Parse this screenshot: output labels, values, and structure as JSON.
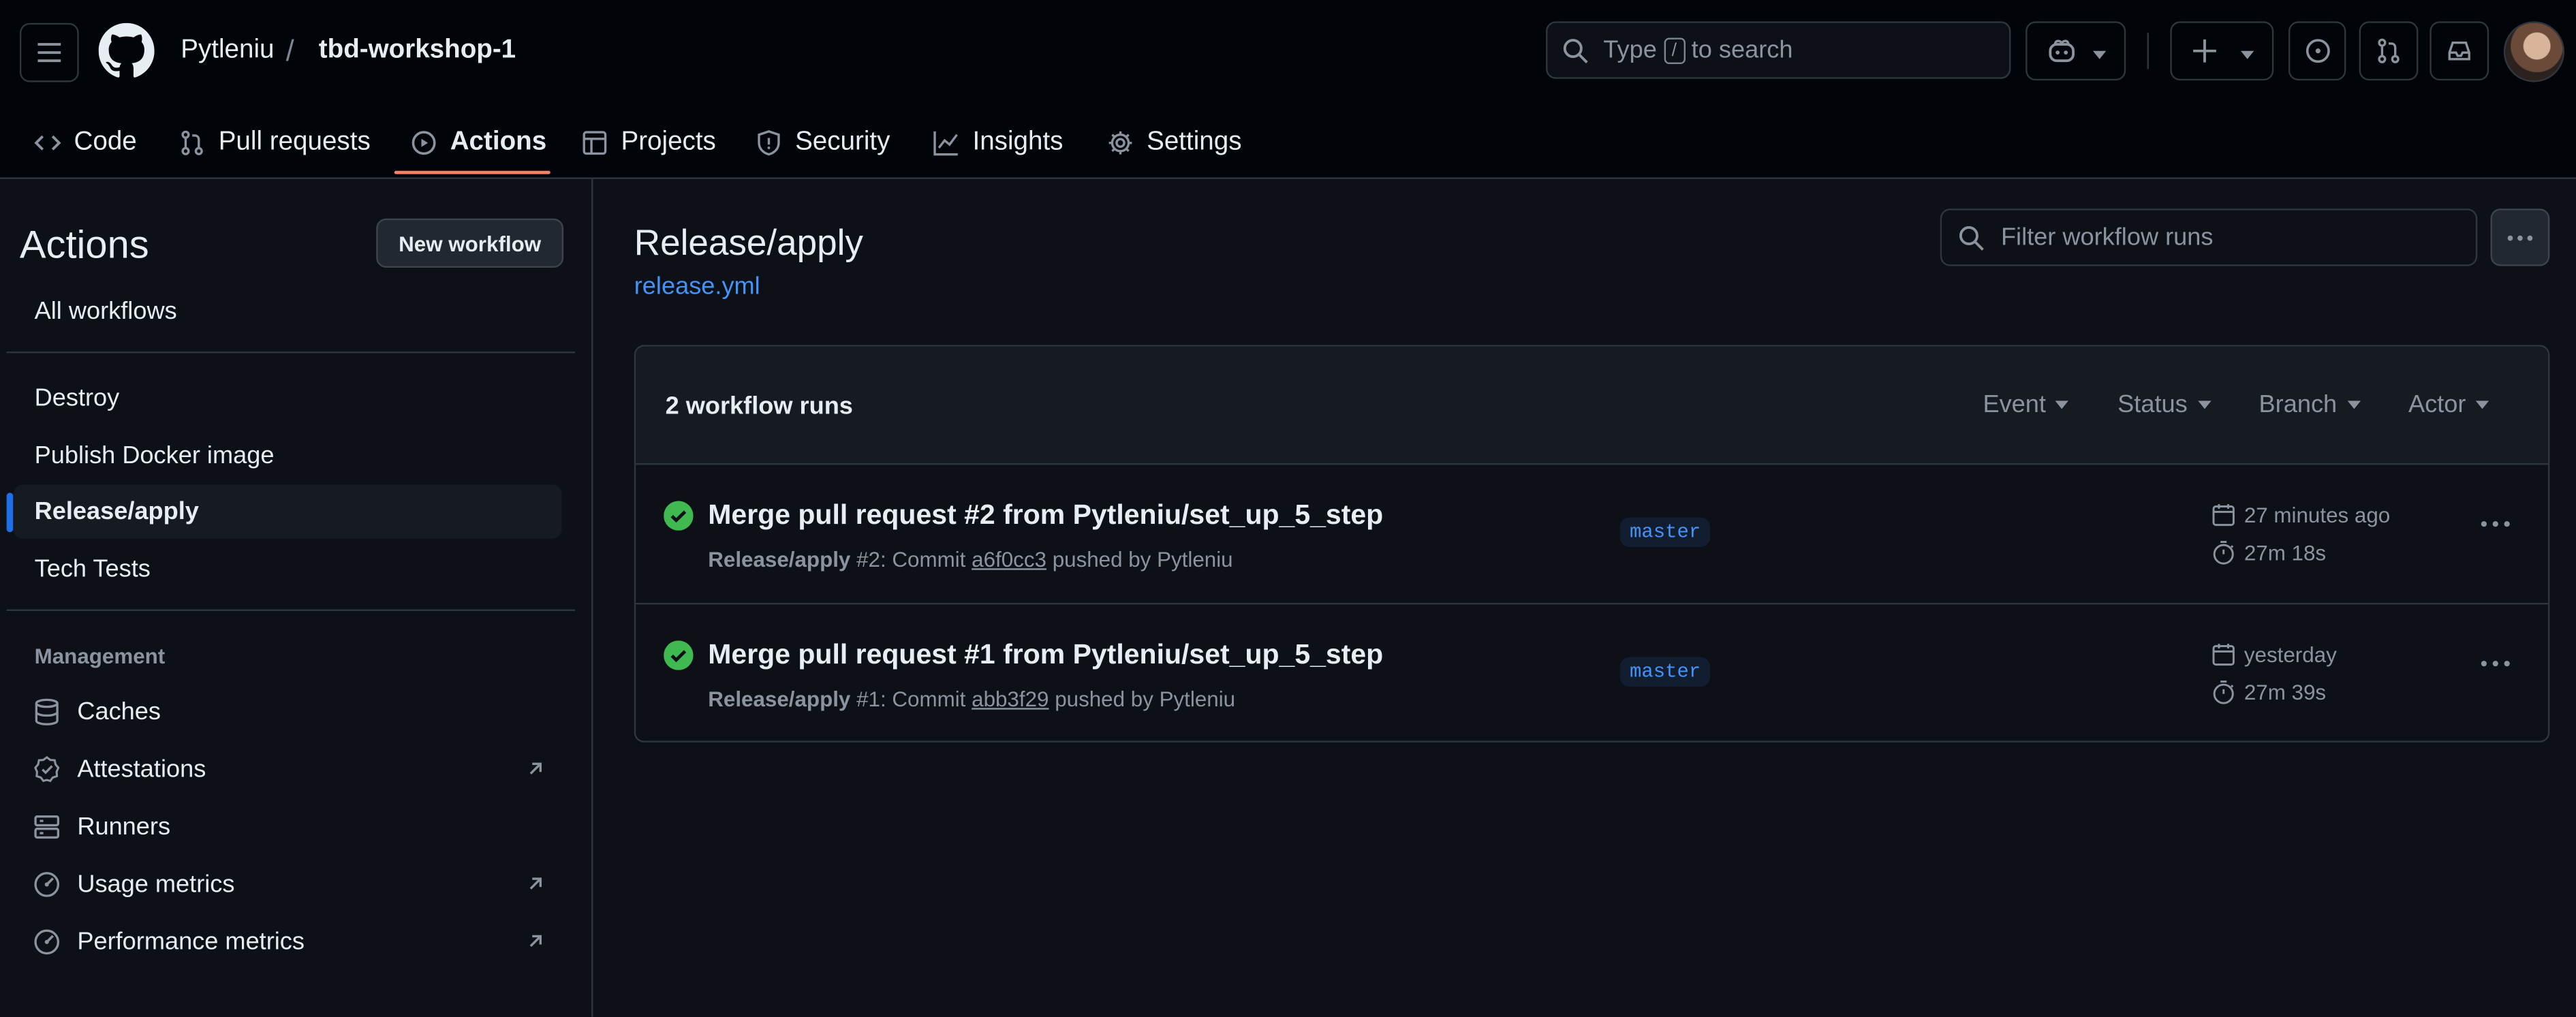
{
  "header": {
    "owner": "Pytleniu",
    "separator": "/",
    "repo": "tbd-workshop-1",
    "search": {
      "prefix": "Type",
      "key": "/",
      "suffix": "to search"
    },
    "icons": [
      "hamburger-icon",
      "github-logo-icon",
      "copilot-icon",
      "plus-icon",
      "issues-icon",
      "pull-requests-icon",
      "inbox-icon"
    ]
  },
  "tabs": [
    {
      "label": "Code",
      "icon": "code-icon"
    },
    {
      "label": "Pull requests",
      "icon": "git-pull-request-icon"
    },
    {
      "label": "Actions",
      "icon": "play-icon"
    },
    {
      "label": "Projects",
      "icon": "table-icon"
    },
    {
      "label": "Security",
      "icon": "shield-icon"
    },
    {
      "label": "Insights",
      "icon": "graph-icon"
    },
    {
      "label": "Settings",
      "icon": "gear-icon"
    }
  ],
  "sidebar": {
    "title": "Actions",
    "new_workflow": "New workflow",
    "all_workflows": "All workflows",
    "workflows": [
      "Destroy",
      "Publish Docker image",
      "Release/apply",
      "Tech Tests"
    ],
    "management_heading": "Management",
    "management": [
      {
        "label": "Caches",
        "icon": "database-icon"
      },
      {
        "label": "Attestations",
        "icon": "verified-icon"
      },
      {
        "label": "Runners",
        "icon": "server-icon"
      },
      {
        "label": "Usage metrics",
        "icon": "meter-icon"
      },
      {
        "label": "Performance metrics",
        "icon": "meter-icon"
      }
    ]
  },
  "main": {
    "title": "Release/apply",
    "file": "release.yml",
    "filter_placeholder": "Filter workflow runs",
    "run_count": "2 workflow runs",
    "filters": [
      "Event",
      "Status",
      "Branch",
      "Actor"
    ],
    "runs": [
      {
        "title": "Merge pull request #2 from Pytleniu/set_up_5_step",
        "workflow": "Release/apply",
        "number": "#2: Commit",
        "sha": "a6f0cc3",
        "pushed_by": "pushed by Pytleniu",
        "branch": "master",
        "time": "27 minutes ago",
        "duration": "27m 18s"
      },
      {
        "title": "Merge pull request #1 from Pytleniu/set_up_5_step",
        "workflow": "Release/apply",
        "number": "#1: Commit",
        "sha": "abb3f29",
        "pushed_by": "pushed by Pytleniu",
        "branch": "master",
        "time": "yesterday",
        "duration": "27m 39s"
      }
    ]
  },
  "colors": {
    "background": "#0d1117",
    "accent": "#f78166",
    "link": "#4493f8",
    "success": "#3fb950"
  }
}
